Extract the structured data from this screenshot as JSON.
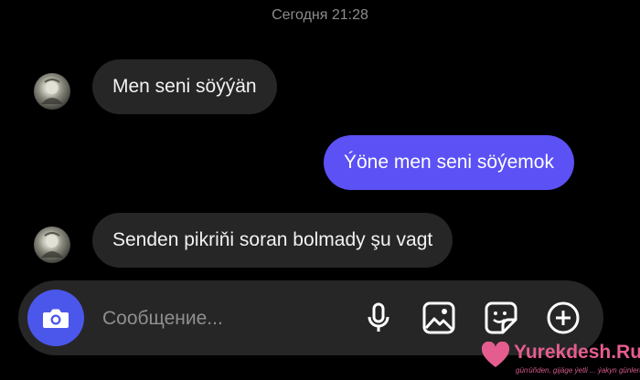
{
  "header": {
    "timestamp": "Сегодня 21:28"
  },
  "messages": [
    {
      "direction": "incoming",
      "text": "Men seni söýýän"
    },
    {
      "direction": "outgoing",
      "text": "Ýöne men seni söýemok"
    },
    {
      "direction": "incoming",
      "text": "Senden pikriňi soran bolmady şu vagt"
    }
  ],
  "composer": {
    "placeholder": "Сообщение...",
    "camera_icon": "camera-icon",
    "tools": [
      "microphone-icon",
      "image-icon",
      "sticker-icon",
      "add-icon"
    ]
  },
  "watermark": {
    "title": "Yurekdesh.Ru",
    "subtitle": "gürrüňden, gijäge ýetli ... ýakyn günlerde"
  },
  "colors": {
    "background": "#000000",
    "incoming_bubble": "#262626",
    "outgoing_bubble": "#5b51f5",
    "camera_button": "#4b57ea",
    "watermark": "#e55d8f"
  }
}
